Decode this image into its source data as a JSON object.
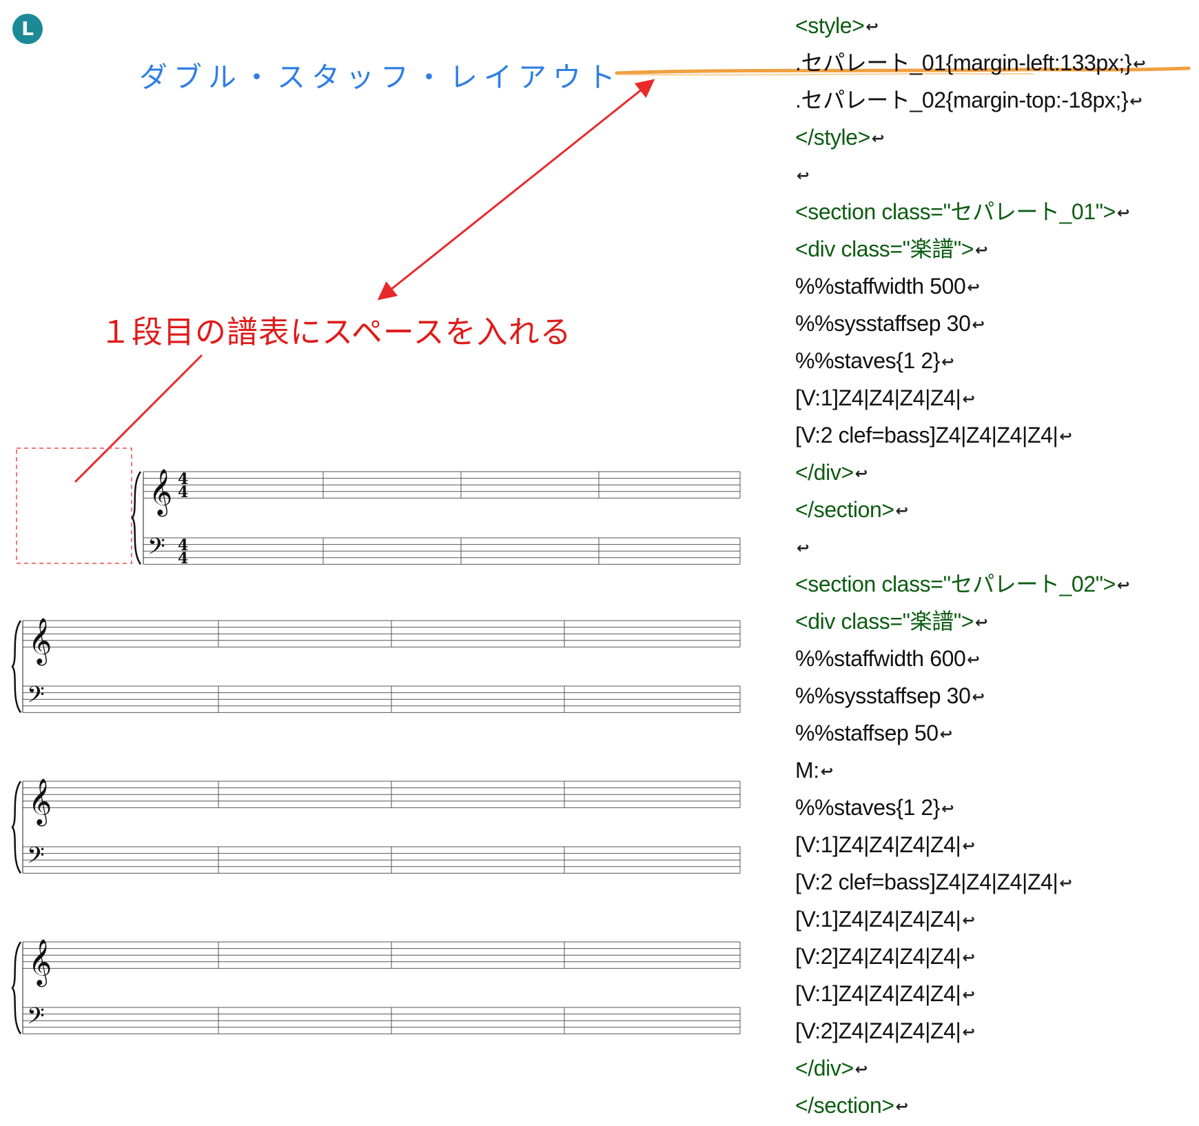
{
  "badge": {
    "label": "L"
  },
  "title": "ダブル・スタッフ・レイアウト",
  "annotation": "１段目の譜表にスペースを入れる",
  "score": {
    "time_signature": {
      "numerator": "4",
      "denominator": "4"
    },
    "systems": [
      {
        "measures": 4,
        "has_time_signature": true
      },
      {
        "measures": 4,
        "has_time_signature": false
      },
      {
        "measures": 4,
        "has_time_signature": false
      },
      {
        "measures": 4,
        "has_time_signature": false
      }
    ]
  },
  "code_lines": [
    {
      "text": "<style>",
      "kind": "tag"
    },
    {
      "text": ".セパレート_01{margin-left:133px;}",
      "kind": "text"
    },
    {
      "text": ".セパレート_02{margin-top:-18px;}",
      "kind": "text"
    },
    {
      "text": "</style>",
      "kind": "tag"
    },
    {
      "text": "",
      "kind": "gap"
    },
    {
      "text": "<section class=\"セパレート_01\">",
      "kind": "tag"
    },
    {
      "text": "<div class=\"楽譜\">",
      "kind": "tag"
    },
    {
      "text": "%%staffwidth 500",
      "kind": "text"
    },
    {
      "text": "%%sysstaffsep 30",
      "kind": "text"
    },
    {
      "text": "%%staves{1 2}",
      "kind": "text"
    },
    {
      "text": "[V:1]Z4|Z4|Z4|Z4|",
      "kind": "text"
    },
    {
      "text": "[V:2 clef=bass]Z4|Z4|Z4|Z4|",
      "kind": "text"
    },
    {
      "text": "</div>",
      "kind": "tag"
    },
    {
      "text": "</section>",
      "kind": "tag"
    },
    {
      "text": "",
      "kind": "gap"
    },
    {
      "text": "<section class=\"セパレート_02\">",
      "kind": "tag"
    },
    {
      "text": "<div class=\"楽譜\">",
      "kind": "tag"
    },
    {
      "text": "%%staffwidth 600",
      "kind": "text"
    },
    {
      "text": "%%sysstaffsep 30",
      "kind": "text"
    },
    {
      "text": "%%staffsep 50",
      "kind": "text"
    },
    {
      "text": "M:",
      "kind": "text"
    },
    {
      "text": "%%staves{1 2}",
      "kind": "text"
    },
    {
      "text": "[V:1]Z4|Z4|Z4|Z4|",
      "kind": "text"
    },
    {
      "text": "[V:2 clef=bass]Z4|Z4|Z4|Z4|",
      "kind": "text"
    },
    {
      "text": "[V:1]Z4|Z4|Z4|Z4|",
      "kind": "text"
    },
    {
      "text": "[V:2]Z4|Z4|Z4|Z4|",
      "kind": "text"
    },
    {
      "text": "[V:1]Z4|Z4|Z4|Z4|",
      "kind": "text"
    },
    {
      "text": "[V:2]Z4|Z4|Z4|Z4|",
      "kind": "text"
    },
    {
      "text": "</div>",
      "kind": "tag"
    },
    {
      "text": "</section>",
      "kind": "tag"
    }
  ],
  "colors": {
    "title": "#2f7fe3",
    "annotation": "#e01b1b",
    "tag": "#0c5c11",
    "badge": "#1b8a96",
    "underline": "#f0a040"
  }
}
